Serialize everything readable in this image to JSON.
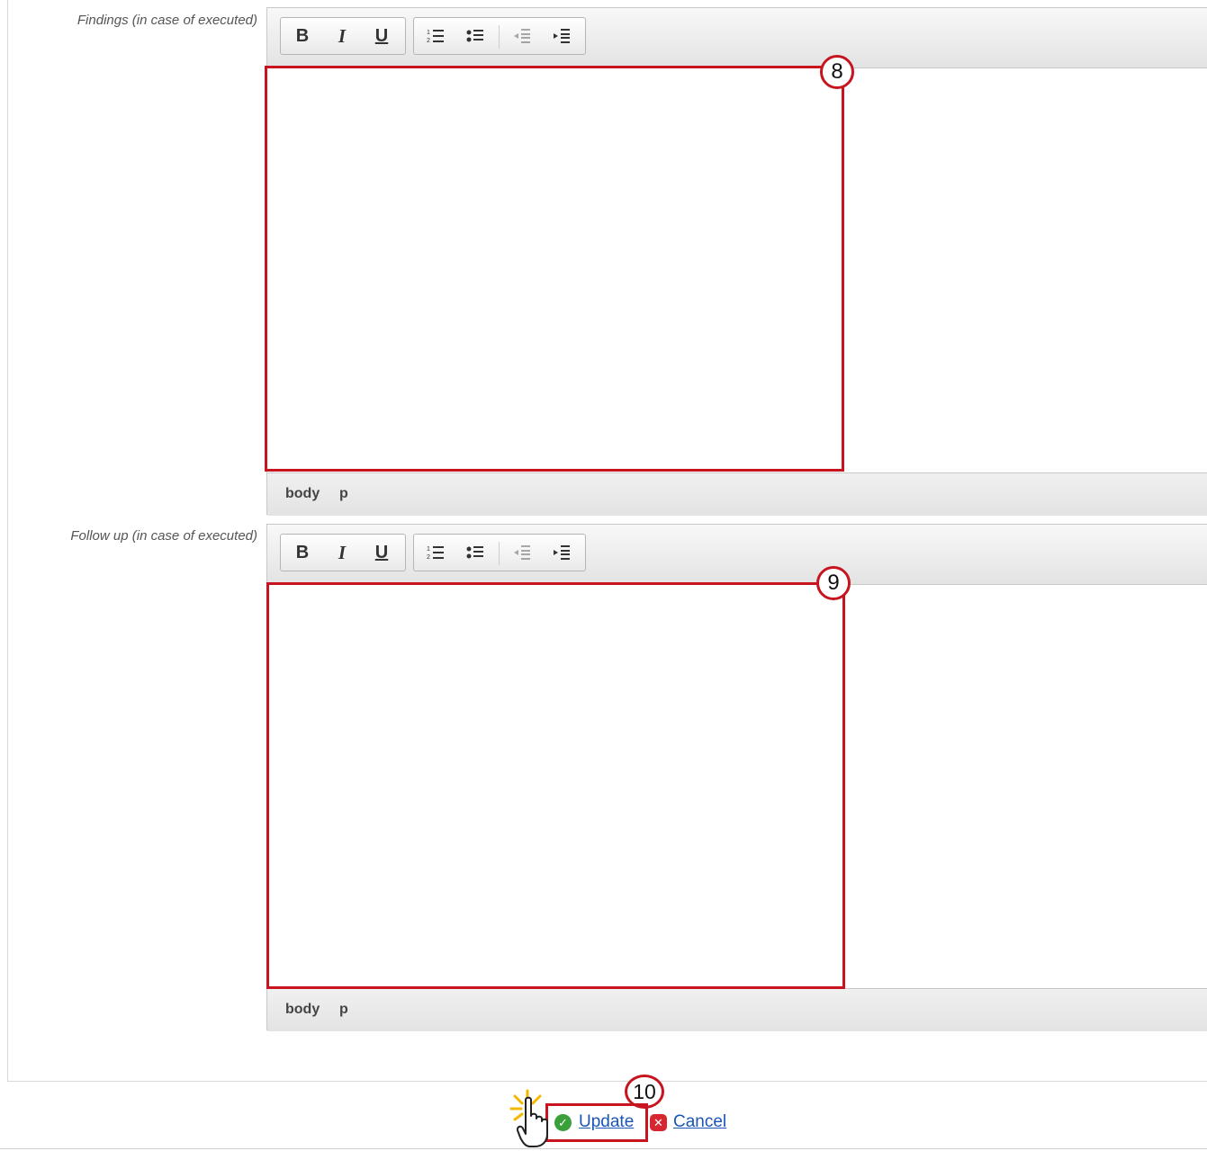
{
  "findings": {
    "label": "Findings (in case of executed)",
    "callout": "8",
    "status_path": [
      "body",
      "p"
    ]
  },
  "follow_up": {
    "label": "Follow up (in case of executed)",
    "callout": "9",
    "status_path": [
      "body",
      "p"
    ]
  },
  "toolbar": {
    "bold": "B",
    "italic": "I",
    "underline": "U"
  },
  "icons": {
    "bold": "bold-icon",
    "italic": "italic-icon",
    "underline": "underline-icon",
    "ordered_list": "ordered-list-icon",
    "unordered_list": "unordered-list-icon",
    "outdent": "outdent-icon",
    "indent": "indent-icon",
    "update": "check-circle-icon",
    "cancel": "x-circle-icon",
    "cursor": "hand-pointer-icon"
  },
  "actions": {
    "callout": "10",
    "update_label": "Update",
    "cancel_label": "Cancel"
  },
  "colors": {
    "highlight": "#c8141e",
    "link": "#1a55b8",
    "update_icon": "#3aa03a",
    "cancel_icon": "#d6262f"
  }
}
